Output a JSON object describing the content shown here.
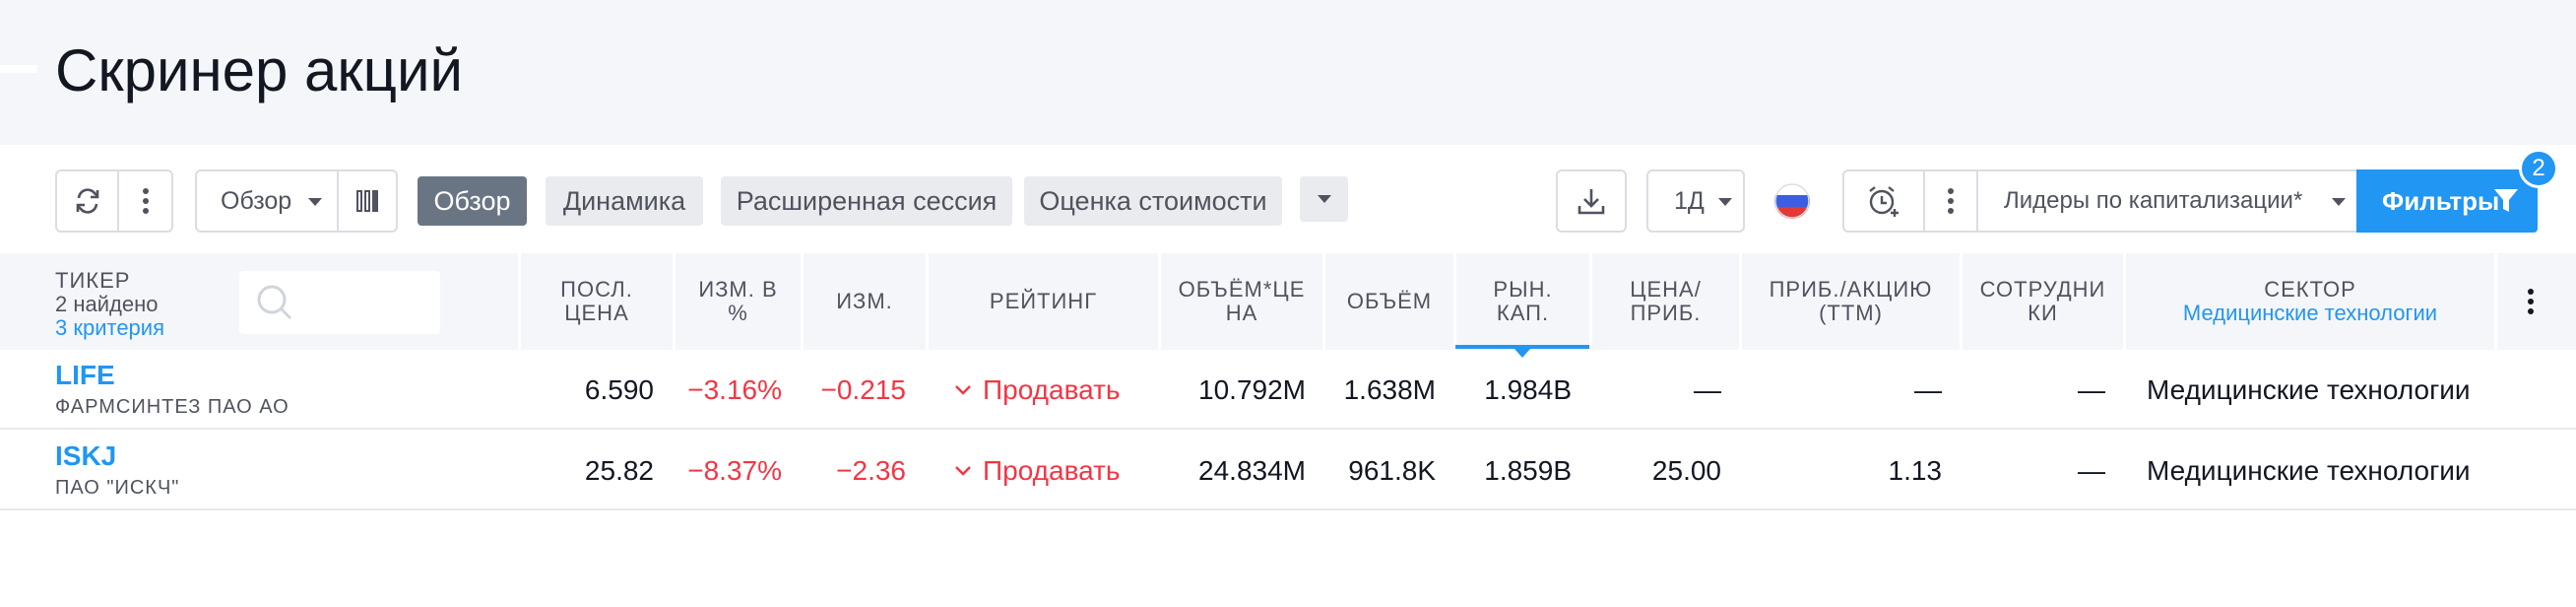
{
  "page": {
    "title": "Скринер акций"
  },
  "toolbar": {
    "view_select_label": "Обзор",
    "tabs": [
      {
        "label": "Обзор",
        "active": true
      },
      {
        "label": "Динамика",
        "active": false
      },
      {
        "label": "Расширенная сессия",
        "active": false
      },
      {
        "label": "Оценка стоимости",
        "active": false
      }
    ],
    "interval_label": "1Д",
    "preset_label": "Лидеры по капитализации*",
    "filters_label": "Фильтры",
    "filters_count": "2",
    "icons": {
      "refresh": "refresh-icon",
      "more": "more-vertical-icon",
      "columns": "columns-icon",
      "chevron": "chevron-down-icon",
      "download": "download-icon",
      "flag": "russia-flag-icon",
      "alert": "alarm-clock-plus-icon",
      "filter": "filter-funnel-icon"
    }
  },
  "table": {
    "ticker_header": "ТИКЕР",
    "found": "2 найдено",
    "criteria": "3 критерия",
    "columns": [
      {
        "key": "price",
        "label": "ПОСЛ. ЦЕНА"
      },
      {
        "key": "chg_pct",
        "label": "ИЗМ. В %"
      },
      {
        "key": "chg",
        "label": "ИЗМ."
      },
      {
        "key": "rating",
        "label": "РЕЙТИНГ"
      },
      {
        "key": "vol_price",
        "label": "ОБЪЁМ*ЦЕНА"
      },
      {
        "key": "volume",
        "label": "ОБЪЁМ"
      },
      {
        "key": "mkt_cap",
        "label": "РЫН. КАП.",
        "sorted": "desc"
      },
      {
        "key": "pe",
        "label": "ЦЕНА/ ПРИБ."
      },
      {
        "key": "eps",
        "label": "ПРИБ./АКЦИЮ (TTM)"
      },
      {
        "key": "employees",
        "label": "СОТРУДНИКИ"
      },
      {
        "key": "sector",
        "label": "СЕКТОР",
        "sub": "Медицинские технологии"
      }
    ],
    "rows": [
      {
        "symbol": "LIFE",
        "name": "ФАРМСИНТЕЗ ПАО АО",
        "price": "6.590",
        "chg_pct": "−3.16%",
        "chg": "−0.215",
        "rating": "Продавать",
        "vol_price": "10.792M",
        "volume": "1.638M",
        "mkt_cap": "1.984B",
        "pe": "—",
        "eps": "—",
        "employees": "—",
        "sector": "Медицинские технологии"
      },
      {
        "symbol": "ISKJ",
        "name": "ПАО \"ИСКЧ\"",
        "price": "25.82",
        "chg_pct": "−8.37%",
        "chg": "−2.36",
        "rating": "Продавать",
        "vol_price": "24.834M",
        "volume": "961.8K",
        "mkt_cap": "1.859B",
        "pe": "25.00",
        "eps": "1.13",
        "employees": "—",
        "sector": "Медицинские технологии"
      }
    ]
  },
  "colors": {
    "accent": "#2196f3",
    "negative": "#f23645",
    "header_bg": "#f5f6fa",
    "active_tab": "#6a7584"
  }
}
